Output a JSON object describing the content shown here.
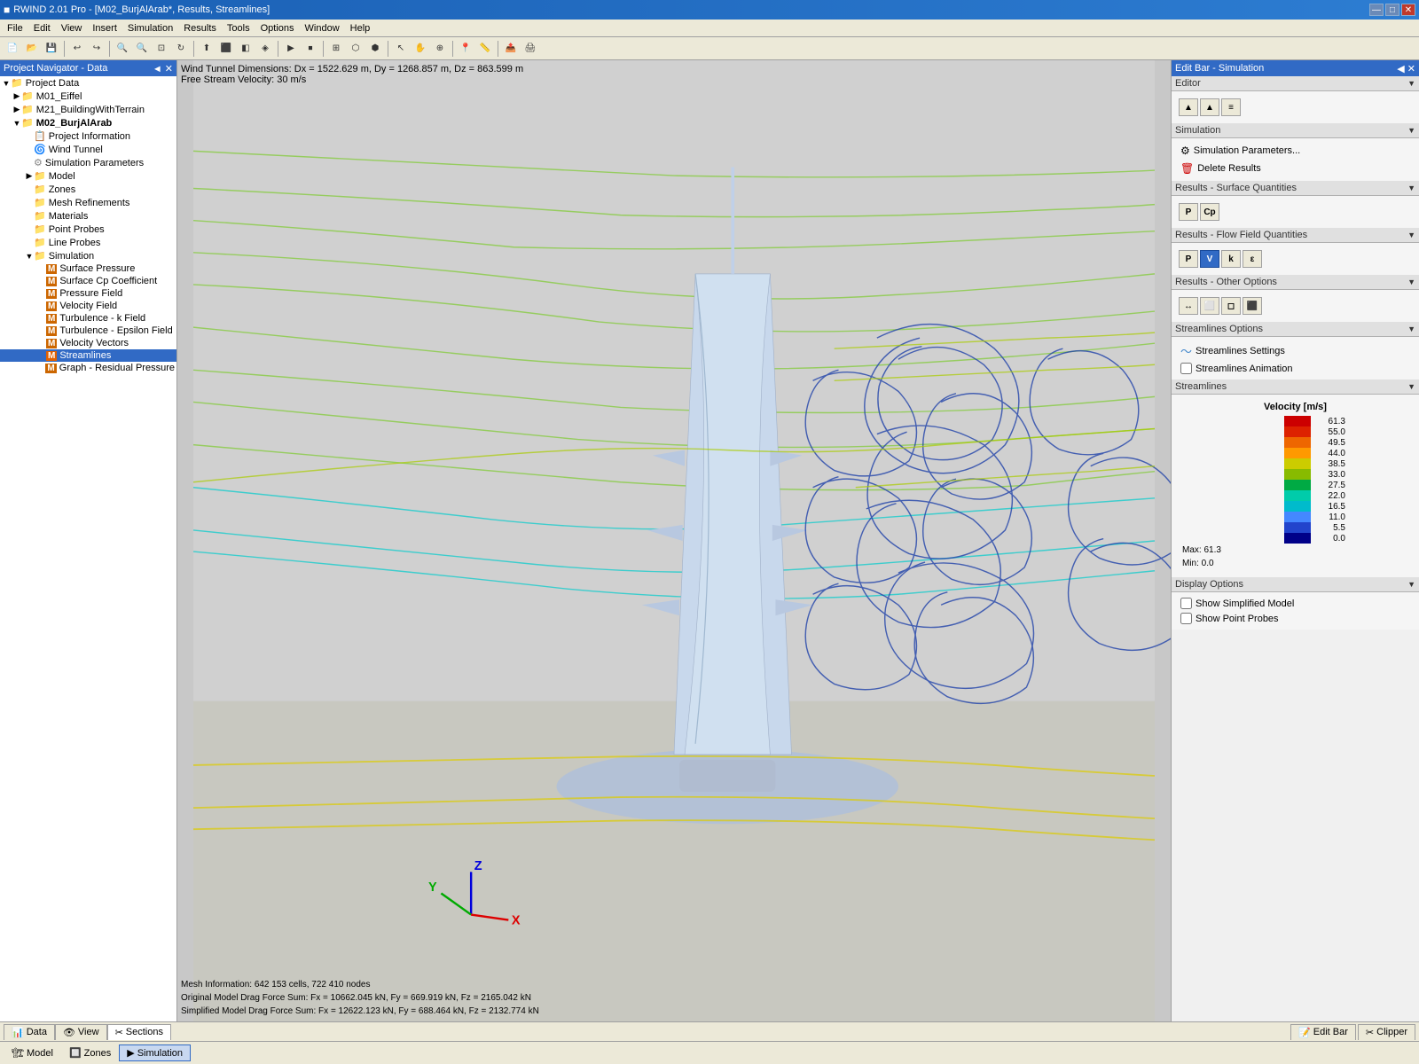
{
  "titleBar": {
    "title": "RWIND 2.01 Pro - [M02_BurjAlArab*, Results, Streamlines]",
    "appIcon": "■",
    "winBtns": [
      "—",
      "□",
      "✕"
    ]
  },
  "menuBar": {
    "items": [
      "File",
      "Edit",
      "View",
      "Insert",
      "Simulation",
      "Results",
      "Tools",
      "Options",
      "Window",
      "Help"
    ]
  },
  "leftPanel": {
    "header": "Project Navigator - Data",
    "collapseBtn": "◄",
    "tree": [
      {
        "id": "root",
        "indent": 0,
        "expand": "▼",
        "icon": "📁",
        "label": "Project Data",
        "type": "folder"
      },
      {
        "id": "m01",
        "indent": 1,
        "expand": "▶",
        "icon": "📁",
        "label": "M01_Eiffel",
        "type": "folder"
      },
      {
        "id": "m21",
        "indent": 1,
        "expand": "▶",
        "icon": "📁",
        "label": "M21_BuildingWithTerrain",
        "type": "folder"
      },
      {
        "id": "m02",
        "indent": 1,
        "expand": "▼",
        "icon": "📁",
        "label": "M02_BurjAlArab",
        "type": "folder",
        "bold": true
      },
      {
        "id": "projinfo",
        "indent": 2,
        "expand": " ",
        "icon": "📋",
        "label": "Project Information",
        "type": "item"
      },
      {
        "id": "wt",
        "indent": 2,
        "expand": " ",
        "icon": "🌀",
        "label": "Wind Tunnel",
        "type": "item"
      },
      {
        "id": "simparam",
        "indent": 2,
        "expand": " ",
        "icon": "⚙",
        "label": "Simulation Parameters",
        "type": "item"
      },
      {
        "id": "model",
        "indent": 2,
        "expand": "▶",
        "icon": "📁",
        "label": "Model",
        "type": "folder"
      },
      {
        "id": "zones",
        "indent": 2,
        "expand": " ",
        "icon": "📁",
        "label": "Zones",
        "type": "item"
      },
      {
        "id": "meshrefs",
        "indent": 2,
        "expand": " ",
        "icon": "📁",
        "label": "Mesh Refinements",
        "type": "item"
      },
      {
        "id": "materials",
        "indent": 2,
        "expand": " ",
        "icon": "📁",
        "label": "Materials",
        "type": "item"
      },
      {
        "id": "pointprobes",
        "indent": 2,
        "expand": " ",
        "icon": "📁",
        "label": "Point Probes",
        "type": "item"
      },
      {
        "id": "lineprobes",
        "indent": 2,
        "expand": " ",
        "icon": "📁",
        "label": "Line Probes",
        "type": "item"
      },
      {
        "id": "simulation",
        "indent": 2,
        "expand": "▼",
        "icon": "📁",
        "label": "Simulation",
        "type": "folder"
      },
      {
        "id": "surfpressure",
        "indent": 3,
        "expand": " ",
        "icon": "M",
        "label": "Surface Pressure",
        "type": "sim",
        "iconColor": "#e05000"
      },
      {
        "id": "surfcp",
        "indent": 3,
        "expand": " ",
        "icon": "M",
        "label": "Surface Cp Coefficient",
        "type": "sim",
        "iconColor": "#e05000"
      },
      {
        "id": "pressfield",
        "indent": 3,
        "expand": " ",
        "icon": "M",
        "label": "Pressure Field",
        "type": "sim",
        "iconColor": "#e05000"
      },
      {
        "id": "velfield",
        "indent": 3,
        "expand": " ",
        "icon": "M",
        "label": "Velocity Field",
        "type": "sim",
        "iconColor": "#e05000"
      },
      {
        "id": "turbkfield",
        "indent": 3,
        "expand": " ",
        "icon": "M",
        "label": "Turbulence - k Field",
        "type": "sim",
        "iconColor": "#e05000"
      },
      {
        "id": "turbepsfield",
        "indent": 3,
        "expand": " ",
        "icon": "M",
        "label": "Turbulence - Epsilon Field",
        "type": "sim",
        "iconColor": "#e05000"
      },
      {
        "id": "velectors",
        "indent": 3,
        "expand": " ",
        "icon": "M",
        "label": "Velocity Vectors",
        "type": "sim",
        "iconColor": "#e05000"
      },
      {
        "id": "streamlines",
        "indent": 3,
        "expand": " ",
        "icon": "M",
        "label": "Streamlines",
        "type": "sim",
        "iconColor": "#e05000",
        "selected": true
      },
      {
        "id": "graphresid",
        "indent": 3,
        "expand": " ",
        "icon": "M",
        "label": "Graph - Residual Pressure",
        "type": "sim",
        "iconColor": "#e05000"
      }
    ]
  },
  "viewport": {
    "infoTop": "Wind Tunnel Dimensions: Dx = 1522.629 m, Dy = 1268.857 m, Dz = 863.599 m\nFree Stream Velocity: 30 m/s",
    "infoBottom": "Mesh Information: 642 153 cells, 722 410 nodes\nOriginal Model Drag Force Sum: Fx = 10662.045 kN, Fy = 669.919 kN, Fz = 2165.042 kN\nSimplified Model Drag Force Sum: Fx = 12622.123 kN, Fy = 688.464 kN, Fz = 2132.774 kN"
  },
  "rightPanel": {
    "header": "Edit Bar - Simulation",
    "sections": {
      "editor": {
        "label": "Editor",
        "buttons": [
          "↑",
          "↑",
          "≡"
        ]
      },
      "simulation": {
        "label": "Simulation",
        "actions": [
          {
            "icon": "⚙",
            "label": "Simulation Parameters..."
          },
          {
            "icon": "🗑",
            "label": "Delete Results"
          }
        ]
      },
      "surfaceQuantities": {
        "label": "Results - Surface Quantities",
        "buttons": [
          "P",
          "Cp"
        ]
      },
      "flowField": {
        "label": "Results - Flow Field Quantities",
        "buttons": [
          {
            "label": "P",
            "active": false
          },
          {
            "label": "V",
            "active": true
          },
          {
            "label": "k",
            "active": false
          },
          {
            "label": "ε",
            "active": false
          }
        ]
      },
      "otherOptions": {
        "label": "Results - Other Options",
        "buttons": [
          "↔",
          "⬜",
          "◻",
          "⬛"
        ]
      },
      "streamlinesOptions": {
        "label": "Streamlines Options",
        "items": [
          {
            "icon": "〜",
            "label": "Streamlines Settings"
          },
          {
            "icon": "▶",
            "label": "Streamlines Animation",
            "checkbox": true
          }
        ]
      },
      "streamlines": {
        "label": "Streamlines",
        "legend": {
          "title": "Velocity [m/s]",
          "entries": [
            {
              "color": "#cc0000",
              "value": "61.3"
            },
            {
              "color": "#dd2200",
              "value": "55.0"
            },
            {
              "color": "#ee6600",
              "value": "49.5"
            },
            {
              "color": "#ff9900",
              "value": "44.0"
            },
            {
              "color": "#cccc00",
              "value": "38.5"
            },
            {
              "color": "#88bb00",
              "value": "33.0"
            },
            {
              "color": "#00aa44",
              "value": "27.5"
            },
            {
              "color": "#00ccaa",
              "value": "22.0"
            },
            {
              "color": "#00bbcc",
              "value": "16.5"
            },
            {
              "color": "#4488ff",
              "value": "11.0"
            },
            {
              "color": "#2244cc",
              "value": "5.5"
            },
            {
              "color": "#000088",
              "value": "0.0"
            }
          ],
          "max": "Max:  61.3",
          "min": "Min:  0.0"
        }
      },
      "displayOptions": {
        "label": "Display Options",
        "items": [
          {
            "label": "Show Simplified Model",
            "checked": false
          },
          {
            "label": "Show Point Probes",
            "checked": false
          }
        ]
      }
    }
  },
  "statusBar": {
    "tabs": [
      "Data",
      "View",
      "Sections"
    ],
    "activeTab": "Sections",
    "rightBtns": [
      "Edit Bar",
      "Clipper"
    ]
  },
  "bottomBar": {
    "tabs": [
      "Model",
      "Zones",
      "Simulation"
    ],
    "activeTab": "Simulation"
  }
}
